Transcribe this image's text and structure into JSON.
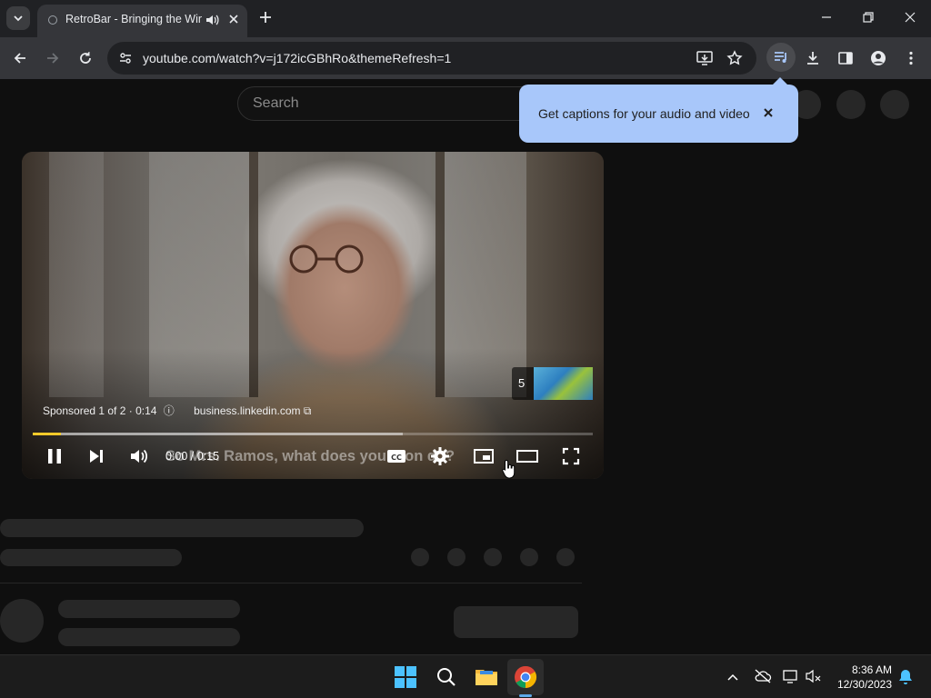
{
  "browser": {
    "tab_title": "RetroBar - Bringing the Windows",
    "url": "youtube.com/watch?v=j172icGBhRo&themeRefresh=1"
  },
  "youtube": {
    "search_placeholder": "Search",
    "caption_promo": "Get captions for your audio and video"
  },
  "player": {
    "ad_info": "Sponsored 1 of 2 · 0:14",
    "ad_link": "business.linkedin.com",
    "ad_queue_count": "5",
    "time": "0:00 / 0:15",
    "caption_text": "So Mrs. Ramos, what does your son do?",
    "played_fraction": 0.05,
    "buffered_fraction": 0.66,
    "accent_color": "#fcca2a"
  },
  "taskbar": {
    "time": "8:36 AM",
    "date": "12/30/2023"
  }
}
